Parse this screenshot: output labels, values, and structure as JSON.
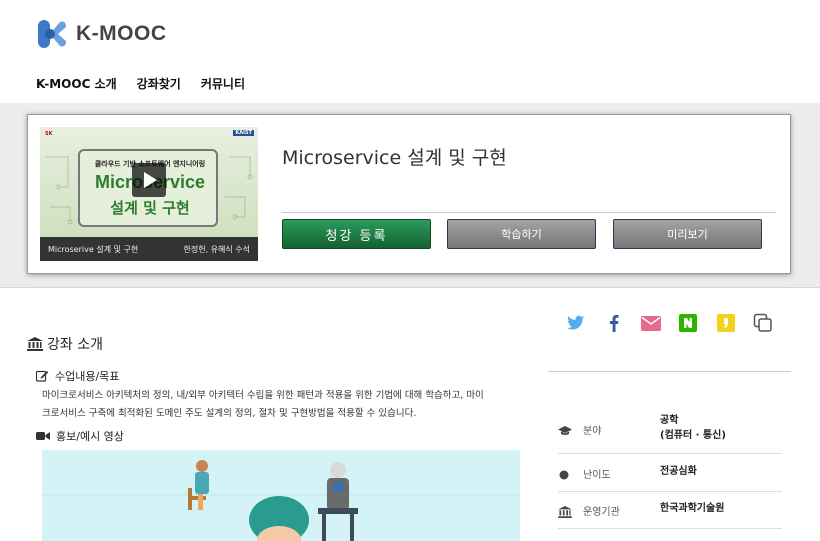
{
  "brand": {
    "name": "K-MOOC"
  },
  "nav": {
    "items": [
      "K-MOOC 소개",
      "강좌찾기",
      "커뮤니티"
    ]
  },
  "course": {
    "title": "Microservice 설계 및 구현",
    "thumbnail": {
      "badge_left": "SK",
      "badge_right": "KAIST",
      "subtitle": "클라우드 기반 소프트웨어 엔지니어링",
      "title_line1": "Microservice",
      "title_line2": "설계 및 구현",
      "caption_left": "Microserive 설계 및 구현",
      "caption_right": "한정헌, 유혜식 수석"
    },
    "buttons": {
      "enroll": "청강 등록",
      "learn": "학습하기",
      "preview": "미리보기"
    }
  },
  "share": {
    "icons": [
      "twitter-icon",
      "facebook-icon",
      "email-icon",
      "naver-icon",
      "kakao-icon",
      "copy-icon"
    ]
  },
  "intro": {
    "section_title": "강좌 소개",
    "goal_title": "수업내용/목표",
    "goal_text_line1": "마이크로서비스 아키텍처의 정의, 내/외부 아키텍터 수립을 위한 패턴과 적용을 위한 기법에 대해 학습하고, 마이",
    "goal_text_line2": "크로서비스 구축에 최적화된 도메인 주도 설계의 정의, 절차 및 구현방법을 적용할 수 있습니다.",
    "video_title": "홍보/예시 영상"
  },
  "info": {
    "field_label": "분야",
    "field_value_line1": "공학",
    "field_value_line2": "(컴퓨터 · 통신)",
    "level_label": "난이도",
    "level_value": "전공심화",
    "org_label": "운영기관",
    "org_value": "한국과학기술원"
  },
  "colors": {
    "enroll_green": "#1d7d44",
    "twitter": "#55acee",
    "facebook": "#3b5998",
    "email": "#e86a8a",
    "naver": "#2db400",
    "kakao": "#f2d21c"
  }
}
